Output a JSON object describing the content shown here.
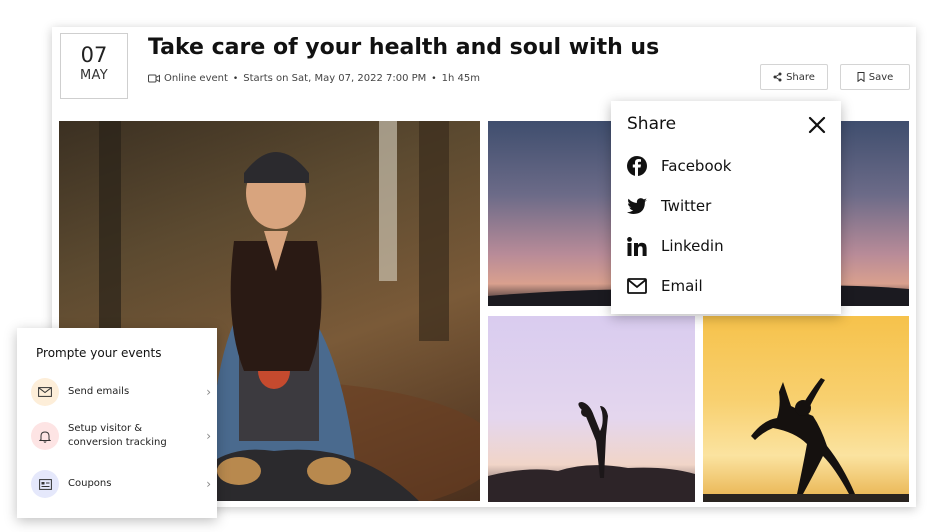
{
  "event": {
    "day": "07",
    "month": "MAY",
    "title": "Take care of your health and soul with us",
    "type": "Online event",
    "starts": "Starts on Sat, May 07, 2022 7:00 PM",
    "duration": "1h 45m"
  },
  "actions": {
    "share_label": "Share",
    "save_label": "Save"
  },
  "share_popup": {
    "title": "Share",
    "items": [
      {
        "label": "Facebook",
        "icon": "facebook-icon"
      },
      {
        "label": "Twitter",
        "icon": "twitter-icon"
      },
      {
        "label": "Linkedin",
        "icon": "linkedin-icon"
      },
      {
        "label": "Email",
        "icon": "mail-icon"
      }
    ]
  },
  "promote": {
    "title": "Prompte your events",
    "items": [
      {
        "label": "Send emails",
        "icon": "envelope-icon",
        "icon_bg": "#fdeed9"
      },
      {
        "label": "Setup visitor & conversion tracking",
        "icon": "bell-icon",
        "icon_bg": "#fde4e4"
      },
      {
        "label": "Coupons",
        "icon": "coupon-icon",
        "icon_bg": "#e5e8fb"
      }
    ]
  },
  "colors": {
    "text": "#111111",
    "muted": "#444444",
    "border": "#d4d4d4"
  }
}
